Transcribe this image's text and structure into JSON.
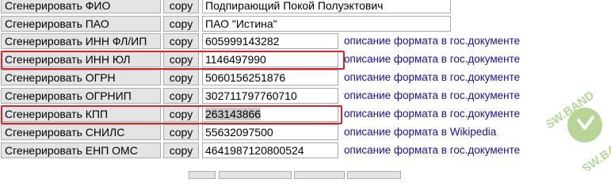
{
  "rows": [
    {
      "gen_label": "Сгенерировать ФИО",
      "copy_label": "copy",
      "value": "Подпирающий Покой Полуэктович",
      "link": ""
    },
    {
      "gen_label": "Сгенерировать ПАО",
      "copy_label": "copy",
      "value": "ПАО \"Истина\"",
      "link": ""
    },
    {
      "gen_label": "Сгенерировать ИНН ФЛ/ИП",
      "copy_label": "copy",
      "value": "605999143282",
      "link": "описание формата в гос.документе"
    },
    {
      "gen_label": "Сгенерировать ИНН ЮЛ",
      "copy_label": "copy",
      "value": "1146497990",
      "link": "описание формата в гос.документе"
    },
    {
      "gen_label": "Сгенерировать ОГРН",
      "copy_label": "copy",
      "value": "5060156251876",
      "link": "описание формата в гос.документе"
    },
    {
      "gen_label": "Сгенерировать ОГРНИП",
      "copy_label": "copy",
      "value": "302711797760710",
      "link": "описание формата в гос.документе"
    },
    {
      "gen_label": "Сгенерировать КПП",
      "copy_label": "copy",
      "value": "263143866",
      "link": "описание формата в гос.документе"
    },
    {
      "gen_label": "Сгенерировать СНИЛС",
      "copy_label": "copy",
      "value": "55632097500",
      "link": "описание формата в Wikipedia"
    },
    {
      "gen_label": "Сгенерировать ЕНП ОМС",
      "copy_label": "copy",
      "value": "4641987120800524",
      "link": "описание формата в гос.документе"
    }
  ],
  "watermark": {
    "text_top": "SW.BAND",
    "text_bottom": "SW.BAND"
  },
  "colors": {
    "highlight": "#d9232a",
    "link": "#1a0dab",
    "button_bg": "#e4e4e4",
    "watermark": "#7cb342"
  }
}
